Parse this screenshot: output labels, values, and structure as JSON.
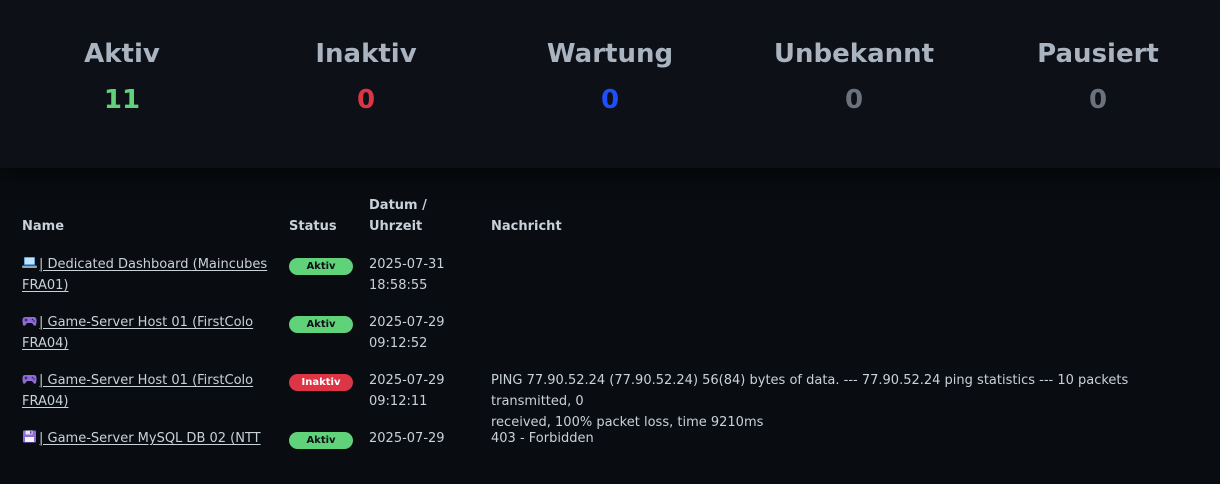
{
  "summary": {
    "stats": [
      {
        "label": "Aktiv",
        "value": "11",
        "color": "#5fd27a"
      },
      {
        "label": "Inaktiv",
        "value": "0",
        "color": "#dc3545"
      },
      {
        "label": "Wartung",
        "value": "0",
        "color": "#1e4fff"
      },
      {
        "label": "Unbekannt",
        "value": "0",
        "color": "#6a737d"
      },
      {
        "label": "Pausiert",
        "value": "0",
        "color": "#6a737d"
      }
    ]
  },
  "table": {
    "headers": {
      "name": "Name",
      "status": "Status",
      "datetime_line1": "Datum /",
      "datetime_line2": "Uhrzeit",
      "message": "Nachricht"
    },
    "rows": [
      {
        "icon": "laptop-icon",
        "name_line1": "| Dedicated Dashboard (Maincubes",
        "name_line2": "FRA01)",
        "status": "Aktiv",
        "date": "2025-07-31",
        "time": "18:58:55",
        "message_line1": "",
        "message_line2": ""
      },
      {
        "icon": "gamepad-icon",
        "name_line1": "| Game-Server Host 01 (FirstColo",
        "name_line2": "FRA04)",
        "status": "Aktiv",
        "date": "2025-07-29",
        "time": "09:12:52",
        "message_line1": "",
        "message_line2": ""
      },
      {
        "icon": "gamepad-icon",
        "name_line1": "| Game-Server Host 01 (FirstColo",
        "name_line2": "FRA04)",
        "status": "Inaktiv",
        "date": "2025-07-29",
        "time": "09:12:11",
        "message_line1": "PING 77.90.52.24 (77.90.52.24) 56(84) bytes of data. --- 77.90.52.24 ping statistics --- 10 packets transmitted, 0",
        "message_line2": "received, 100% packet loss, time 9210ms"
      },
      {
        "icon": "floppy-disk-icon",
        "name_line1": "| Game-Server MySQL DB 02 (NTT",
        "name_line2": "",
        "status": "Aktiv",
        "date": "2025-07-29",
        "time": "",
        "message_line1": "403 - Forbidden",
        "message_line2": ""
      }
    ]
  }
}
